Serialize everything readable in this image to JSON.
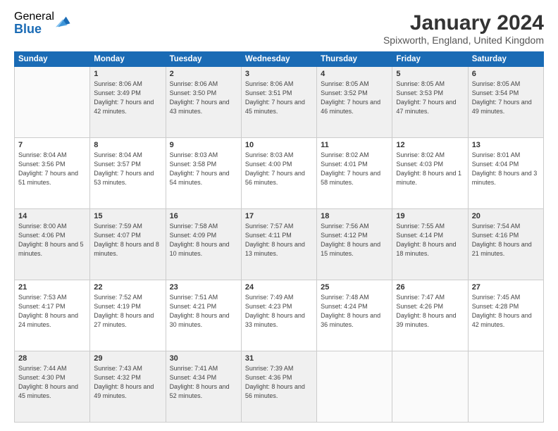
{
  "logo": {
    "general": "General",
    "blue": "Blue"
  },
  "title": "January 2024",
  "location": "Spixworth, England, United Kingdom",
  "weekdays": [
    "Sunday",
    "Monday",
    "Tuesday",
    "Wednesday",
    "Thursday",
    "Friday",
    "Saturday"
  ],
  "rows": [
    [
      {
        "day": "",
        "sunrise": "",
        "sunset": "",
        "daylight": ""
      },
      {
        "day": "1",
        "sunrise": "Sunrise: 8:06 AM",
        "sunset": "Sunset: 3:49 PM",
        "daylight": "Daylight: 7 hours and 42 minutes."
      },
      {
        "day": "2",
        "sunrise": "Sunrise: 8:06 AM",
        "sunset": "Sunset: 3:50 PM",
        "daylight": "Daylight: 7 hours and 43 minutes."
      },
      {
        "day": "3",
        "sunrise": "Sunrise: 8:06 AM",
        "sunset": "Sunset: 3:51 PM",
        "daylight": "Daylight: 7 hours and 45 minutes."
      },
      {
        "day": "4",
        "sunrise": "Sunrise: 8:05 AM",
        "sunset": "Sunset: 3:52 PM",
        "daylight": "Daylight: 7 hours and 46 minutes."
      },
      {
        "day": "5",
        "sunrise": "Sunrise: 8:05 AM",
        "sunset": "Sunset: 3:53 PM",
        "daylight": "Daylight: 7 hours and 47 minutes."
      },
      {
        "day": "6",
        "sunrise": "Sunrise: 8:05 AM",
        "sunset": "Sunset: 3:54 PM",
        "daylight": "Daylight: 7 hours and 49 minutes."
      }
    ],
    [
      {
        "day": "7",
        "sunrise": "Sunrise: 8:04 AM",
        "sunset": "Sunset: 3:56 PM",
        "daylight": "Daylight: 7 hours and 51 minutes."
      },
      {
        "day": "8",
        "sunrise": "Sunrise: 8:04 AM",
        "sunset": "Sunset: 3:57 PM",
        "daylight": "Daylight: 7 hours and 53 minutes."
      },
      {
        "day": "9",
        "sunrise": "Sunrise: 8:03 AM",
        "sunset": "Sunset: 3:58 PM",
        "daylight": "Daylight: 7 hours and 54 minutes."
      },
      {
        "day": "10",
        "sunrise": "Sunrise: 8:03 AM",
        "sunset": "Sunset: 4:00 PM",
        "daylight": "Daylight: 7 hours and 56 minutes."
      },
      {
        "day": "11",
        "sunrise": "Sunrise: 8:02 AM",
        "sunset": "Sunset: 4:01 PM",
        "daylight": "Daylight: 7 hours and 58 minutes."
      },
      {
        "day": "12",
        "sunrise": "Sunrise: 8:02 AM",
        "sunset": "Sunset: 4:03 PM",
        "daylight": "Daylight: 8 hours and 1 minute."
      },
      {
        "day": "13",
        "sunrise": "Sunrise: 8:01 AM",
        "sunset": "Sunset: 4:04 PM",
        "daylight": "Daylight: 8 hours and 3 minutes."
      }
    ],
    [
      {
        "day": "14",
        "sunrise": "Sunrise: 8:00 AM",
        "sunset": "Sunset: 4:06 PM",
        "daylight": "Daylight: 8 hours and 5 minutes."
      },
      {
        "day": "15",
        "sunrise": "Sunrise: 7:59 AM",
        "sunset": "Sunset: 4:07 PM",
        "daylight": "Daylight: 8 hours and 8 minutes."
      },
      {
        "day": "16",
        "sunrise": "Sunrise: 7:58 AM",
        "sunset": "Sunset: 4:09 PM",
        "daylight": "Daylight: 8 hours and 10 minutes."
      },
      {
        "day": "17",
        "sunrise": "Sunrise: 7:57 AM",
        "sunset": "Sunset: 4:11 PM",
        "daylight": "Daylight: 8 hours and 13 minutes."
      },
      {
        "day": "18",
        "sunrise": "Sunrise: 7:56 AM",
        "sunset": "Sunset: 4:12 PM",
        "daylight": "Daylight: 8 hours and 15 minutes."
      },
      {
        "day": "19",
        "sunrise": "Sunrise: 7:55 AM",
        "sunset": "Sunset: 4:14 PM",
        "daylight": "Daylight: 8 hours and 18 minutes."
      },
      {
        "day": "20",
        "sunrise": "Sunrise: 7:54 AM",
        "sunset": "Sunset: 4:16 PM",
        "daylight": "Daylight: 8 hours and 21 minutes."
      }
    ],
    [
      {
        "day": "21",
        "sunrise": "Sunrise: 7:53 AM",
        "sunset": "Sunset: 4:17 PM",
        "daylight": "Daylight: 8 hours and 24 minutes."
      },
      {
        "day": "22",
        "sunrise": "Sunrise: 7:52 AM",
        "sunset": "Sunset: 4:19 PM",
        "daylight": "Daylight: 8 hours and 27 minutes."
      },
      {
        "day": "23",
        "sunrise": "Sunrise: 7:51 AM",
        "sunset": "Sunset: 4:21 PM",
        "daylight": "Daylight: 8 hours and 30 minutes."
      },
      {
        "day": "24",
        "sunrise": "Sunrise: 7:49 AM",
        "sunset": "Sunset: 4:23 PM",
        "daylight": "Daylight: 8 hours and 33 minutes."
      },
      {
        "day": "25",
        "sunrise": "Sunrise: 7:48 AM",
        "sunset": "Sunset: 4:24 PM",
        "daylight": "Daylight: 8 hours and 36 minutes."
      },
      {
        "day": "26",
        "sunrise": "Sunrise: 7:47 AM",
        "sunset": "Sunset: 4:26 PM",
        "daylight": "Daylight: 8 hours and 39 minutes."
      },
      {
        "day": "27",
        "sunrise": "Sunrise: 7:45 AM",
        "sunset": "Sunset: 4:28 PM",
        "daylight": "Daylight: 8 hours and 42 minutes."
      }
    ],
    [
      {
        "day": "28",
        "sunrise": "Sunrise: 7:44 AM",
        "sunset": "Sunset: 4:30 PM",
        "daylight": "Daylight: 8 hours and 45 minutes."
      },
      {
        "day": "29",
        "sunrise": "Sunrise: 7:43 AM",
        "sunset": "Sunset: 4:32 PM",
        "daylight": "Daylight: 8 hours and 49 minutes."
      },
      {
        "day": "30",
        "sunrise": "Sunrise: 7:41 AM",
        "sunset": "Sunset: 4:34 PM",
        "daylight": "Daylight: 8 hours and 52 minutes."
      },
      {
        "day": "31",
        "sunrise": "Sunrise: 7:39 AM",
        "sunset": "Sunset: 4:36 PM",
        "daylight": "Daylight: 8 hours and 56 minutes."
      },
      {
        "day": "",
        "sunrise": "",
        "sunset": "",
        "daylight": ""
      },
      {
        "day": "",
        "sunrise": "",
        "sunset": "",
        "daylight": ""
      },
      {
        "day": "",
        "sunrise": "",
        "sunset": "",
        "daylight": ""
      }
    ]
  ]
}
